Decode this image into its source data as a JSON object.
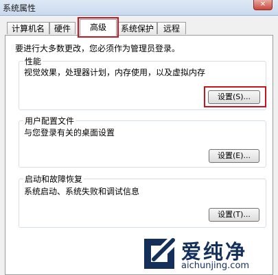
{
  "window": {
    "title": "系统属性",
    "close_glyph": "✕"
  },
  "tabs": [
    {
      "label": "计算机名",
      "active": false
    },
    {
      "label": "硬件",
      "active": false
    },
    {
      "label": "高级",
      "active": true
    },
    {
      "label": "系统保护",
      "active": false
    },
    {
      "label": "远程",
      "active": false
    }
  ],
  "advanced": {
    "admin_note": "要进行大多数更改，您必须作为管理员登录。",
    "performance": {
      "title": "性能",
      "description": "视觉效果，处理器计划，内存使用，以及虚拟内存",
      "button_label": "设置(S)..."
    },
    "user_profiles": {
      "title": "用户配置文件",
      "description": "与您登录有关的桌面设置",
      "button_label": "设置(E)..."
    },
    "startup_recovery": {
      "title": "启动和故障恢复",
      "description": "系统启动、系统失败和调试信息",
      "button_label": "设置(T)..."
    }
  },
  "watermark": {
    "brand": "爱纯净",
    "url": "aichunjing.com"
  },
  "colors": {
    "highlight": "#c8121e",
    "watermark": "#14305a"
  }
}
